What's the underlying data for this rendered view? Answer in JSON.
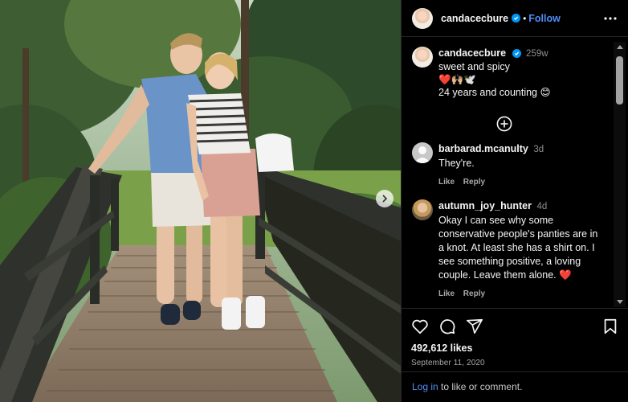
{
  "post": {
    "username": "candacecbure",
    "follow_label": "Follow",
    "dot": "•",
    "more_icon": "more-horizontal-icon",
    "caption": {
      "username": "candacecbure",
      "time": "259w",
      "line1": "sweet and spicy",
      "line2": "❤️🙌🏼🕊️",
      "line3": "24 years and counting 😊"
    },
    "load_more_icon": "plus-circle-icon",
    "comments": [
      {
        "username": "barbarad.mcanulty",
        "time": "3d",
        "text": "They're.",
        "like_label": "Like",
        "reply_label": "Reply",
        "avatar": "default-avatar"
      },
      {
        "username": "autumn_joy_hunter",
        "time": "4d",
        "text": "Okay I can see why some conservative people's panties are in a knot. At least she has a shirt on. I see something positive, a loving couple. Leave them alone. ❤️",
        "like_label": "Like",
        "reply_label": "Reply",
        "avatar": "photo-avatar"
      }
    ],
    "likes": "492,612 likes",
    "date": "September 11, 2020",
    "login_link": "Log in",
    "login_rest": " to like or comment."
  },
  "colors": {
    "background": "#000000",
    "accent": "#4f8ef7",
    "verified": "#0095f6",
    "muted": "#8e8e8e"
  }
}
